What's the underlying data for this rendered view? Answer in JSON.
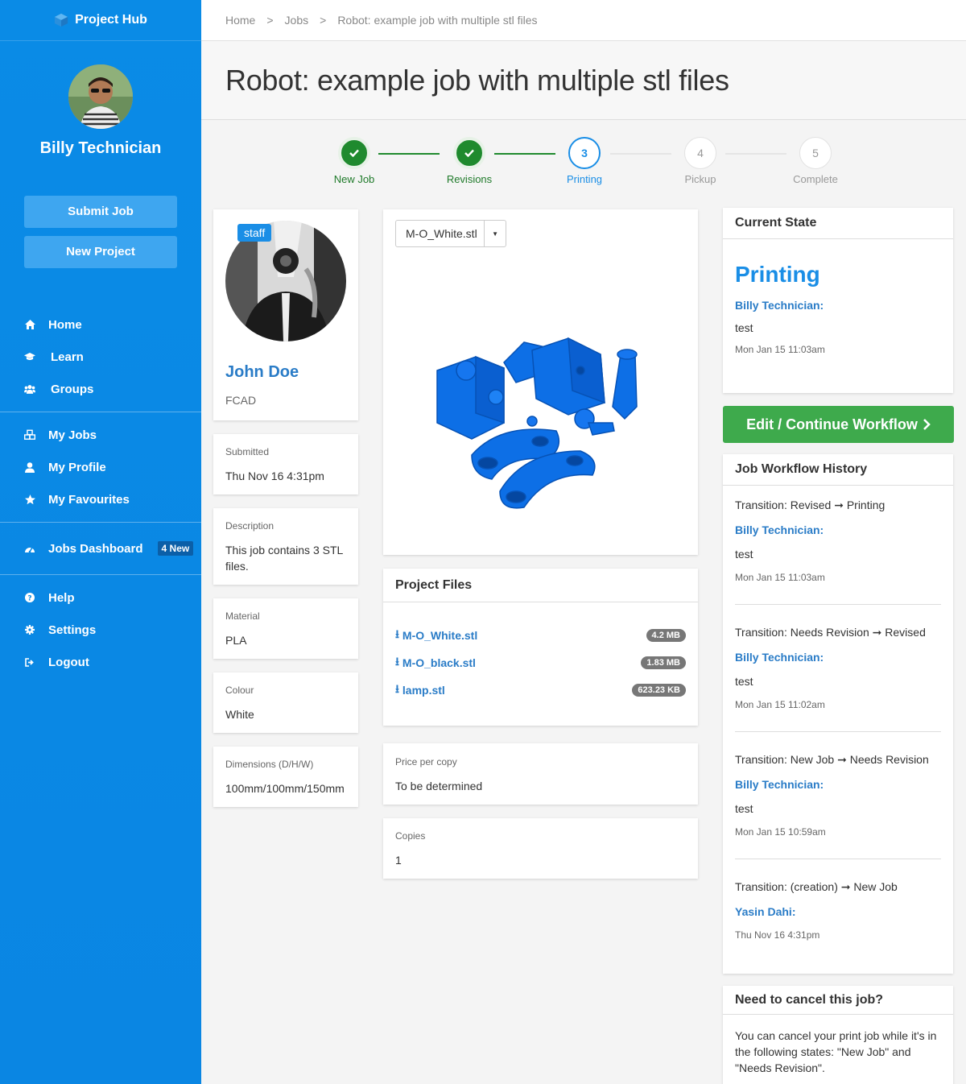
{
  "app": {
    "brand": "Project Hub"
  },
  "sidebar": {
    "user_name": "Billy Technician",
    "buttons": {
      "submit": "Submit Job",
      "new_project": "New Project"
    },
    "nav": {
      "home": "Home",
      "learn": "Learn",
      "groups": "Groups",
      "my_jobs": "My Jobs",
      "my_profile": "My Profile",
      "my_favourites": "My Favourites",
      "jobs_dashboard": "Jobs Dashboard",
      "jobs_dashboard_badge": "4 New",
      "help": "Help",
      "settings": "Settings",
      "logout": "Logout"
    }
  },
  "breadcrumb": {
    "home": "Home",
    "sep": ">",
    "jobs": "Jobs",
    "current": "Robot: example job with multiple stl files"
  },
  "page": {
    "title": "Robot: example job with multiple stl files"
  },
  "stepper": {
    "steps": [
      {
        "num": "",
        "label": "New Job",
        "status": "done"
      },
      {
        "num": "",
        "label": "Revisions",
        "status": "done"
      },
      {
        "num": "3",
        "label": "Printing",
        "status": "active"
      },
      {
        "num": "4",
        "label": "Pickup",
        "status": "todo"
      },
      {
        "num": "5",
        "label": "Complete",
        "status": "todo"
      }
    ]
  },
  "owner": {
    "tag": "staff",
    "name": "John Doe",
    "dept": "FCAD"
  },
  "details": {
    "submitted_label": "Submitted",
    "submitted_value": "Thu Nov 16 4:31pm",
    "description_label": "Description",
    "description_value": "This job contains 3 STL files.",
    "material_label": "Material",
    "material_value": "PLA",
    "colour_label": "Colour",
    "colour_value": "White",
    "dimensions_label": "Dimensions (D/H/W)",
    "dimensions_value": "100mm/100mm/150mm"
  },
  "viewer": {
    "selected_file": "M-O_White.stl"
  },
  "project_files": {
    "title": "Project Files",
    "files": [
      {
        "name": "M-O_White.stl",
        "size": "4.2 MB"
      },
      {
        "name": "M-O_black.stl",
        "size": "1.83 MB"
      },
      {
        "name": "lamp.stl",
        "size": "623.23 KB"
      }
    ]
  },
  "pricing": {
    "price_label": "Price per copy",
    "price_value": "To be determined",
    "copies_label": "Copies",
    "copies_value": "1"
  },
  "current_state": {
    "title": "Current State",
    "state": "Printing",
    "actor": "Billy Technician",
    "note": "test",
    "time": "Mon Jan 15 11:03am"
  },
  "workflow_button": "Edit / Continue Workflow",
  "history": {
    "title": "Job Workflow History",
    "items": [
      {
        "transition": "Transition: Revised ➞ Printing",
        "actor": "Billy Technician",
        "note": "test",
        "time": "Mon Jan 15 11:03am"
      },
      {
        "transition": "Transition: Needs Revision ➞ Revised",
        "actor": "Billy Technician",
        "note": "test",
        "time": "Mon Jan 15 11:02am"
      },
      {
        "transition": "Transition: New Job ➞ Needs Revision",
        "actor": "Billy Technician",
        "note": "test",
        "time": "Mon Jan 15 10:59am"
      },
      {
        "transition": "Transition: (creation) ➞ New Job",
        "actor": "Yasin Dahi",
        "note": "",
        "time": "Thu Nov 16 4:31pm"
      }
    ]
  },
  "cancel": {
    "title": "Need to cancel this job?",
    "text": "You can cancel your print job while it's in the following states: \"New Job\" and \"Needs Revision\"."
  },
  "colors": {
    "sidebar": "#0a8be6",
    "accent": "#1a8ee6",
    "success": "#3eaa4c",
    "done": "#1f8a2e"
  }
}
